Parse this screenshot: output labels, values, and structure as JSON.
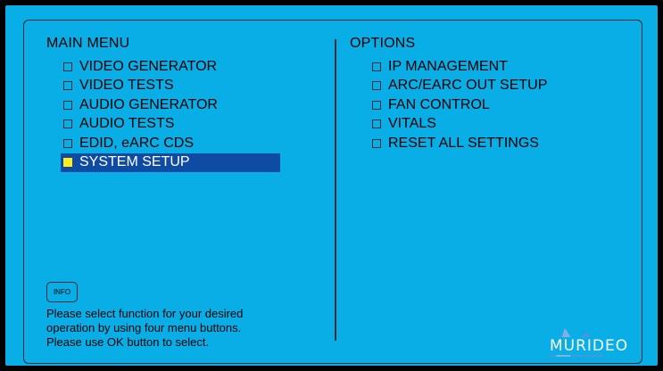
{
  "main_menu": {
    "title": "MAIN MENU",
    "items": [
      {
        "label": "VIDEO GENERATOR",
        "selected": false
      },
      {
        "label": "VIDEO TESTS",
        "selected": false
      },
      {
        "label": "AUDIO GENERATOR",
        "selected": false
      },
      {
        "label": "AUDIO TESTS",
        "selected": false
      },
      {
        "label": "EDID, eARC CDS",
        "selected": false
      },
      {
        "label": "SYSTEM SETUP",
        "selected": true
      }
    ]
  },
  "options": {
    "title": "OPTIONS",
    "items": [
      {
        "label": "IP MANAGEMENT"
      },
      {
        "label": "ARC/EARC OUT SETUP"
      },
      {
        "label": "FAN CONTROL"
      },
      {
        "label": "VITALS"
      },
      {
        "label": "RESET ALL SETTINGS"
      }
    ]
  },
  "info": {
    "button_label": "INFO",
    "help_lines": [
      "Please select function for your desired",
      "operation by using four menu buttons.",
      "Please use OK button to select."
    ]
  },
  "brand": {
    "logo_text": "MURIDEO"
  },
  "colors": {
    "background": "#0aaee7",
    "selection": "#0f4aa3",
    "selected_box": "#ffec1a"
  }
}
